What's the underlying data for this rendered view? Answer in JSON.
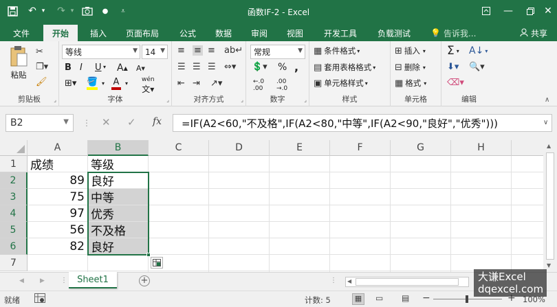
{
  "app": {
    "window_title": "函数IF-2 - Excel",
    "quick_save_icon": "save-icon",
    "undo_icon": "undo-icon",
    "redo_icon": "redo-icon",
    "camera_icon": "camera-icon",
    "customize_icon": "customize-qat-icon"
  },
  "window_controls": {
    "ribbon_display": "ribbon-display-icon",
    "minimize": "minimize-icon",
    "restore": "restore-icon",
    "close": "close-icon"
  },
  "tabs": [
    {
      "label": "文件"
    },
    {
      "label": "开始"
    },
    {
      "label": "插入"
    },
    {
      "label": "页面布局"
    },
    {
      "label": "公式"
    },
    {
      "label": "数据"
    },
    {
      "label": "审阅"
    },
    {
      "label": "视图"
    },
    {
      "label": "开发工具"
    },
    {
      "label": "负载测试"
    }
  ],
  "tell_me": "告诉我...",
  "share": "共享",
  "ribbon": {
    "clipboard": {
      "paste": "粘贴",
      "label": "剪贴板"
    },
    "font": {
      "name": "等线",
      "size": "14",
      "bold": "B",
      "italic": "I",
      "underline": "U",
      "label": "字体",
      "phonetic": "wén",
      "font_color": "#c00000",
      "fill_color": "#ffff00"
    },
    "alignment": {
      "label": "对齐方式"
    },
    "number": {
      "format": "常规",
      "percent": "%",
      "comma": ",",
      "inc": ".00",
      "label": "数字"
    },
    "styles": {
      "conditional": "条件格式",
      "table": "套用表格格式",
      "cell": "单元格样式",
      "label": "样式"
    },
    "cells": {
      "insert": "插入",
      "delete": "删除",
      "format": "格式",
      "label": "单元格"
    },
    "editing": {
      "label": "编辑"
    }
  },
  "formula_bar": {
    "name_box": "B2",
    "cancel": "✕",
    "enter": "✓",
    "fx": "fx",
    "formula": "=IF(A2<60,\"不及格\",IF(A2<80,\"中等\",IF(A2<90,\"良好\",\"优秀\")))"
  },
  "columns": [
    "A",
    "B",
    "C",
    "D",
    "E",
    "F",
    "G",
    "H"
  ],
  "rows": [
    "1",
    "2",
    "3",
    "4",
    "5",
    "6",
    "7"
  ],
  "cells": {
    "A1": "成绩",
    "B1": "等级",
    "A2": "89",
    "B2": "良好",
    "A3": "75",
    "B3": "中等",
    "A4": "97",
    "B4": "优秀",
    "A5": "56",
    "B5": "不及格",
    "A6": "82",
    "B6": "良好"
  },
  "sheet": {
    "tab": "Sheet1",
    "add": "+"
  },
  "status": {
    "ready": "就绪",
    "count": "计数: 5",
    "zoom": "100%",
    "zoom_minus": "−",
    "zoom_plus": "+"
  },
  "watermark": {
    "line1": "大谦Excel",
    "line2": "dqexcel.com"
  },
  "colors": {
    "accent": "#217346",
    "selected_fill": "#d3d3d3"
  }
}
